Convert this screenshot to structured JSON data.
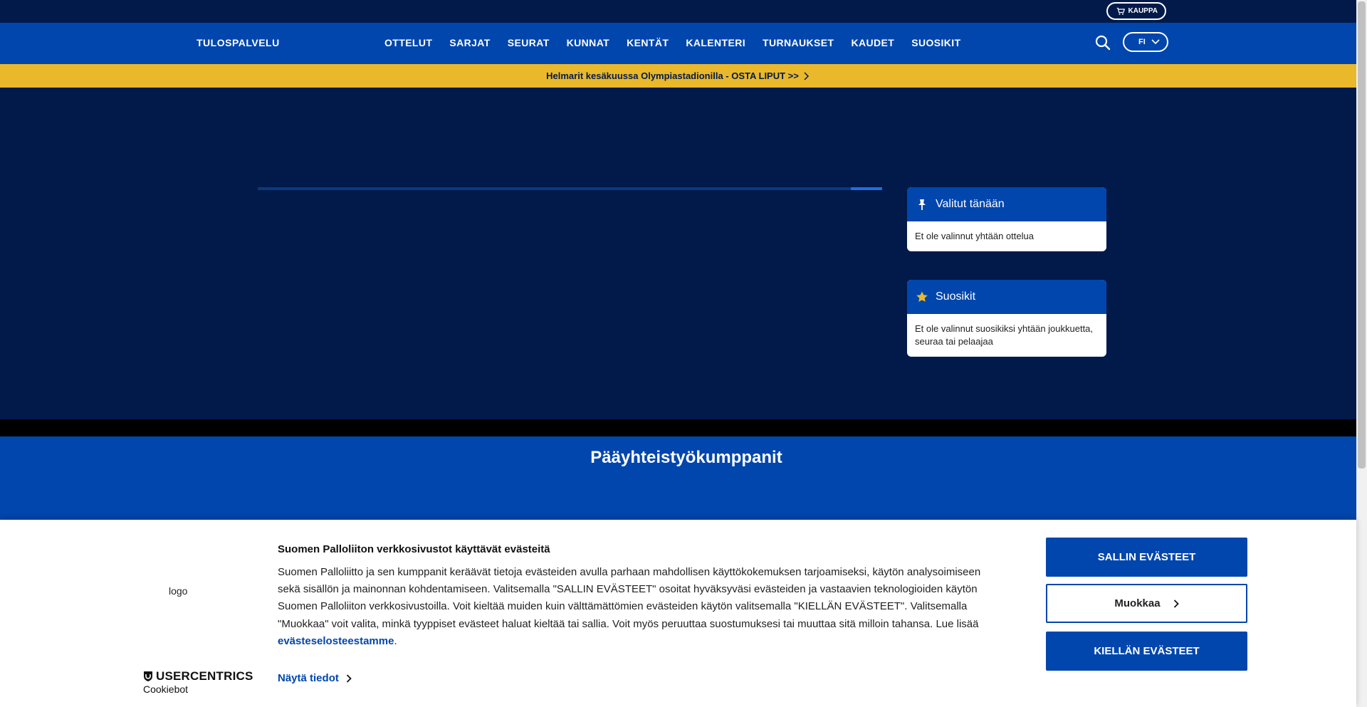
{
  "topbar": {
    "shop_label": "KAUPPA"
  },
  "navbar": {
    "brand": "TULOSPALVELU",
    "items": [
      "OTTELUT",
      "SARJAT",
      "SEURAT",
      "KUNNAT",
      "KENTÄT",
      "KALENTERI",
      "TURNAUKSET",
      "KAUDET",
      "SUOSIKIT"
    ],
    "language": "FI"
  },
  "banner": {
    "text": "Helmarit kesäkuussa Olympiastadionilla - OSTA LIPUT >>"
  },
  "hero": {
    "carousel_progress": 0.05,
    "selected_today": {
      "title": "Valitut tänään",
      "empty": "Et ole valinnut yhtään ottelua"
    },
    "favorites": {
      "title": "Suosikit",
      "empty": "Et ole valinnut suosikiksi yhtään joukkuetta, seuraa tai pelaajaa"
    }
  },
  "partners": {
    "title": "Pääyhteistyökumppanit"
  },
  "cookie": {
    "logo_alt": "logo",
    "brand_name": "USERCENTRICS",
    "brand_sub": "Cookiebot",
    "title": "Suomen Palloliiton verkkosivustot käyttävät evästeitä",
    "body": "Suomen Palloliitto ja sen kumppanit keräävät tietoja evästeiden avulla parhaan mahdollisen käyttökokemuksen tarjoamiseksi, käytön analysoimiseen sekä sisällön ja mainonnan kohdentamiseen. Valitsemalla \"SALLIN EVÄSTEET\" osoitat hyväksyväsi evästeiden ja vastaavien teknologioiden käytön Suomen Palloliiton verkkosivustoilla. Voit kieltää muiden kuin välttämättömien evästeiden käytön valitsemalla \"KIELLÄN EVÄSTEET\". Valitsemalla \"Muokkaa\" voit valita, minkä tyyppiset evästeet haluat kieltää tai sallia. Voit myös peruuttaa suostumuksesi tai muuttaa sitä milloin tahansa. Lue lisää ",
    "link": "evästeselosteestamme",
    "link_suffix": ".",
    "details": "Näytä tiedot",
    "allow": "SALLIN EVÄSTEET",
    "customize": "Muokkaa",
    "deny": "KIELLÄN EVÄSTEET"
  },
  "colors": {
    "navy": "#011a4a",
    "blue": "#0046ad",
    "yellow": "#e9b82b"
  }
}
